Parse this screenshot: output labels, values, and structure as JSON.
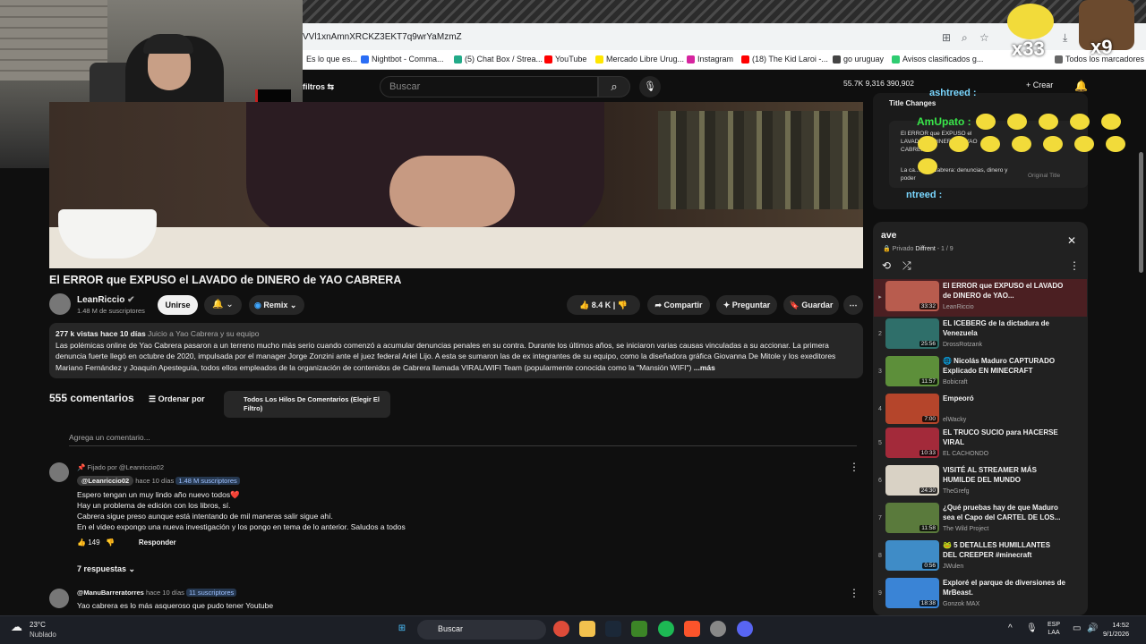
{
  "browser": {
    "url": "VVl1xnAmnXRCKZ3EKT7q9wrYaMzmZ",
    "bookmarks": [
      {
        "label": "Es lo que es...",
        "color": "#888888"
      },
      {
        "label": "Nightbot - Comma...",
        "color": "#2a6df5"
      },
      {
        "label": "(5) Chat Box / Strea...",
        "color": "#22aa88"
      },
      {
        "label": "YouTube",
        "color": "#ff0000"
      },
      {
        "label": "Mercado Libre Urug...",
        "color": "#ffe600"
      },
      {
        "label": "Instagram",
        "color": "#d6249f"
      },
      {
        "label": "(18) The Kid Laroi -...",
        "color": "#ff0000"
      },
      {
        "label": "go uruguay",
        "color": "#444444"
      },
      {
        "label": "Avisos clasificados g...",
        "color": "#2ecc71"
      },
      {
        "label": "Todos los marcadores",
        "color": "#666666"
      }
    ]
  },
  "header": {
    "filtros": "filtros",
    "search_placeholder": "Buscar",
    "stats": "55.7K  9,316  390,902",
    "crear": "Crear",
    "notif_badge": "9+"
  },
  "video": {
    "title": "El ERROR que EXPUSO el LAVADO de DINERO de YAO CABRERA",
    "channel": "LeanRiccio",
    "subscribers": "1.48 M de suscriptores",
    "join": "Unirse",
    "remix": "Remix",
    "likes": "8.4 K",
    "share": "Compartir",
    "ask": "Preguntar",
    "save": "Guardar"
  },
  "description": {
    "views": "277 k vistas",
    "date": "hace 10 días",
    "tag": "Juicio a Yao Cabrera y su equipo",
    "text": "Las polémicas online de Yao Cabrera pasaron a un terreno mucho más serio cuando comenzó a acumular denuncias penales en su contra. Durante los últimos años, se iniciaron varias causas vinculadas a su accionar. La primera denuncia fuerte llegó en octubre de 2020, impulsada por el manager Jorge Zonzini ante el juez federal Ariel Lijo. A esta se sumaron las de ex integrantes de su equipo, como la diseñadora gráfica Giovanna De Mitole y los exeditores Mariano Fernández y Joaquín Apesteguía, todos ellos empleados de la organización de contenidos de Cabrera llamada VIRAL/WIFI Team (popularmente conocida como la \"Mansión WIFI\")",
    "more": "...más"
  },
  "comments": {
    "count": "555 comentarios",
    "sort": "Ordenar por",
    "filter": "Todos Los Hilos De Comentarios (Elegir El Filtro)",
    "add_placeholder": "Agrega un comentario...",
    "c1": {
      "pinned": "Fijado por @Leanriccio02",
      "handle": "@Leanriccio02",
      "time": "hace 10 días",
      "subs": "1.48 M suscriptores",
      "lines": [
        "Espero tengan un muy lindo año nuevo todos❤️",
        "Hay un problema de edición con los libros, sí.",
        "Cabrera sigue preso aunque está intentando de mil maneras salir sigue ahí.",
        "En el video expongo una nueva investigación y los pongo en tema de lo anterior. Saludos a todos"
      ],
      "likes": "149",
      "reply": "Responder",
      "replies": "7 respuestas"
    },
    "c2": {
      "handle": "@ManuBarreratorres",
      "time": "hace 10 días",
      "subs": "11 suscriptores",
      "text": "Yao cabrera es lo más asqueroso que pudo tener Youtube"
    }
  },
  "chat": {
    "title_changes": "Title Changes",
    "amupato": "AmUpato :",
    "ashtreed": "ashtreed :",
    "ashtreed2": "ntreed :",
    "old_title": "El ERROR que EXPUSO el LAVADO de DINERO de YAO CABRERA",
    "new_title": "La ca... Yao Cabrera: denuncias, dinero y poder",
    "original_title": "Original Title",
    "x33": "x33",
    "x9": "x9"
  },
  "playlist": {
    "title": "ave",
    "privacy": "Privado",
    "owner": "Diffrent",
    "position": "1 / 9",
    "items": [
      {
        "n": "▸",
        "title": "El ERROR que EXPUSO el LAVADO de DINERO de YAO...",
        "channel": "LeanRiccio",
        "dur": "33:32",
        "color": "#b85c4e"
      },
      {
        "n": "2",
        "title": "EL ICEBERG de la dictadura de Venezuela",
        "channel": "DrossRotzank",
        "dur": "25:56",
        "color": "#2f6f6a"
      },
      {
        "n": "3",
        "title": "🌐 Nicolás Maduro CAPTURADO Explicado EN MINECRAFT",
        "channel": "Bobicraft",
        "dur": "11:57",
        "color": "#5d8f3a"
      },
      {
        "n": "4",
        "title": "Empeoró",
        "channel": "elWacky",
        "dur": "7:00",
        "color": "#b5452b"
      },
      {
        "n": "5",
        "title": "EL TRUCO SUCIO para HACERSE VIRAL",
        "channel": "EL CACHONDO",
        "dur": "10:33",
        "color": "#a32a3a"
      },
      {
        "n": "6",
        "title": "VISITÉ AL STREAMER MÁS HUMILDE DEL MUNDO",
        "channel": "TheGrefg",
        "dur": "24:30",
        "color": "#d9d2c5"
      },
      {
        "n": "7",
        "title": "¿Qué pruebas hay de que Maduro sea el Capo del CARTEL DE LOS...",
        "channel": "The Wild Project",
        "dur": "11:58",
        "color": "#5a7a3c"
      },
      {
        "n": "8",
        "title": "🐸 5 DETALLES HUMILLANTES DEL CREEPER #minecraft",
        "channel": "JWulen",
        "dur": "0:56",
        "color": "#3f8cc7"
      },
      {
        "n": "9",
        "title": "Exploré el parque de diversiones de MrBeast.",
        "channel": "Gonzok MAX",
        "dur": "18:38",
        "color": "#3a84d6"
      }
    ]
  },
  "taskbar": {
    "temp": "23°C",
    "weather": "Nublado",
    "search": "Buscar",
    "lang_top": "ESP",
    "lang_bottom": "LAA",
    "time": "14:52",
    "date": "9/1/2026"
  }
}
